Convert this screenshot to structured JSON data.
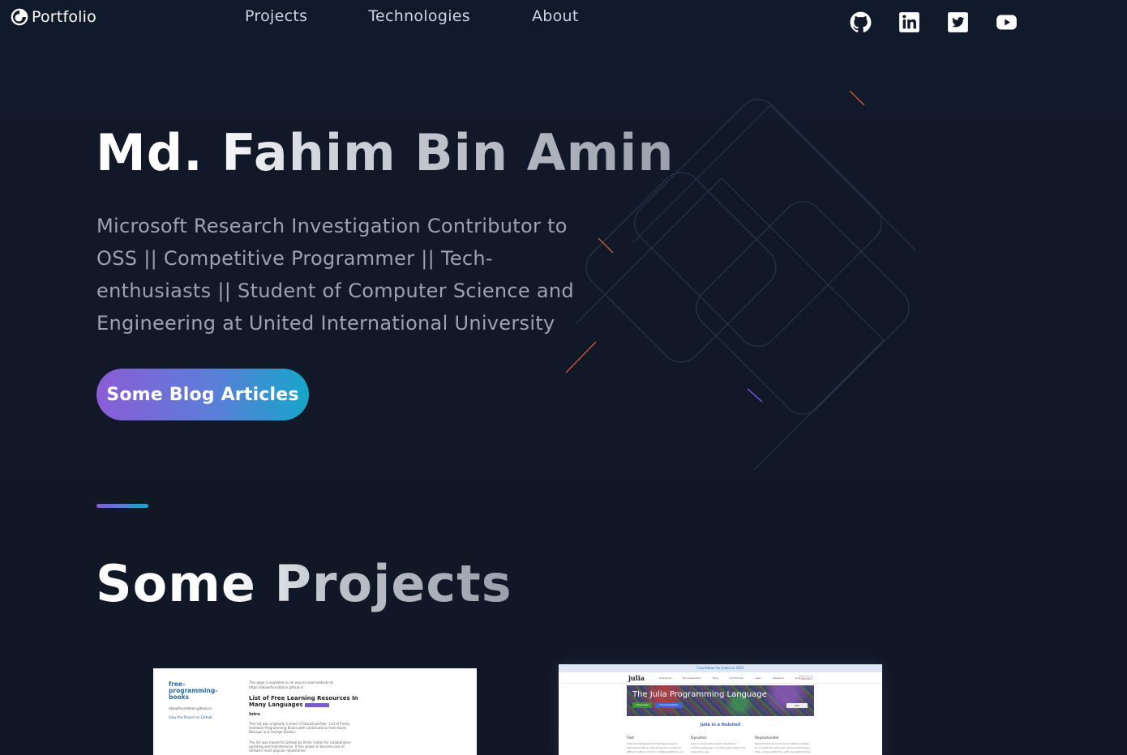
{
  "nav": {
    "brand": "Portfolio",
    "links": [
      "Projects",
      "Technologies",
      "About"
    ],
    "socials": [
      "github-icon",
      "linkedin-icon",
      "twitter-icon",
      "youtube-icon"
    ]
  },
  "hero": {
    "title": "Md. Fahim Bin Amin",
    "subtitle": "Microsoft Research Investigation Contributor to OSS || Competitive Programmer || Tech-enthusiasts || Student of Computer Science and Engineering at United International University",
    "cta_label": "Some Blog Articles"
  },
  "projects": {
    "section_title": "Some Projects",
    "card1": {
      "repo_title": "free-programming-books",
      "user_line": "ebookfoundation.github.io",
      "view_link": "View the Project on GitHub",
      "note": "This page is available as an easy-to-read website at https://ebookfoundation.github.io",
      "heading": "List of Free Learning Resources In Many Languages",
      "intro": "Intro",
      "para1": "This list was originally a clone of StackOverflow - List of Freely Available Programming Books with contributions from Karan Bhangui and George Stocker.",
      "para2": "The list was moved to GitHub by Victor Felder for collaborative updating and maintenance. It has grown to become one of GitHub's most popular repositories."
    },
    "card2": {
      "banner": "Countdown for JuliaCon 2021",
      "logo": "julia",
      "menu": [
        "Download",
        "Documentation",
        "Blog",
        "Community",
        "Learn",
        "Research",
        "Jsoc"
      ],
      "sponsor": "Sponsor",
      "hero_title": "The Julia Programming Language",
      "download": "Download",
      "docs": "Documentation",
      "star": "Star",
      "nutshell": "Julia in a Nutshell",
      "cols": [
        {
          "h": "Fast",
          "t": "Julia was designed from the beginning for high performance. Julia programs compile to efficient native code for multiple platforms via LLVM."
        },
        {
          "h": "Dynamic",
          "t": "Julia is dynamically typed, feels like a scripting language, and has good support for interactive use."
        },
        {
          "h": "Reproducible",
          "t": "Reproducible environments make it possible to recreate the same Julia environment every time, across platforms, with pre-built binaries."
        }
      ]
    }
  },
  "colors": {
    "background": "#111827",
    "gradient_start": "#8b5cd6",
    "gradient_end": "#16a6c9",
    "subtitle": "#9ca3af"
  }
}
